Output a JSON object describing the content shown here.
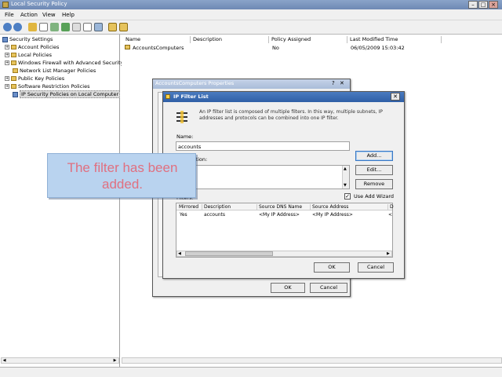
{
  "window": {
    "title": "Local Security Policy"
  },
  "menu": [
    "File",
    "Action",
    "View",
    "Help"
  ],
  "tree": [
    {
      "label": "Security Settings",
      "kind": "root"
    },
    {
      "label": "Account Policies",
      "kind": "folder"
    },
    {
      "label": "Local Policies",
      "kind": "folder"
    },
    {
      "label": "Windows Firewall with Advanced Security",
      "kind": "folder"
    },
    {
      "label": "Network List Manager Policies",
      "kind": "folder"
    },
    {
      "label": "Public Key Policies",
      "kind": "folder"
    },
    {
      "label": "Software Restriction Policies",
      "kind": "folder"
    },
    {
      "label": "IP Security Policies on Local Computer",
      "kind": "ipsec",
      "selected": true
    }
  ],
  "list": {
    "columns": [
      "Name",
      "Description",
      "Policy Assigned",
      "Last Modified Time"
    ],
    "rows": [
      [
        "AccountsComputers",
        "",
        "No",
        "06/05/2009 15:03:42"
      ]
    ]
  },
  "properties_dialog": {
    "title": "AccountsComputers Properties",
    "help": "?",
    "close": "✕",
    "ok": "OK",
    "cancel": "Cancel"
  },
  "ip_filter_dialog": {
    "title": "IP Filter List",
    "close": "✕",
    "description": "An IP filter list is composed of multiple filters. In this way, multiple subnets, IP addresses and protocols can be combined into one IP filter.",
    "name_label": "Name:",
    "name_value": "accounts",
    "description_label": "Description:",
    "filters_label": "Filters:",
    "add": "Add...",
    "edit": "Edit...",
    "remove": "Remove",
    "use_add_wizard": "Use Add Wizard",
    "use_add_wizard_checked": true,
    "columns": [
      "Mirrored",
      "Description",
      "Source DNS Name",
      "Source Address",
      "D"
    ],
    "rows": [
      [
        "Yes",
        "accounts",
        "<My IP Address>",
        "<My IP Address>",
        "<"
      ]
    ],
    "ok": "OK",
    "cancel": "Cancel"
  },
  "callout": {
    "text": "The filter has been added."
  },
  "colors": {
    "titlebar": "#7d97c0",
    "callout_bg": "#b9d3ef",
    "callout_text": "#e07080",
    "dialog_title": "#3b6bb0"
  }
}
